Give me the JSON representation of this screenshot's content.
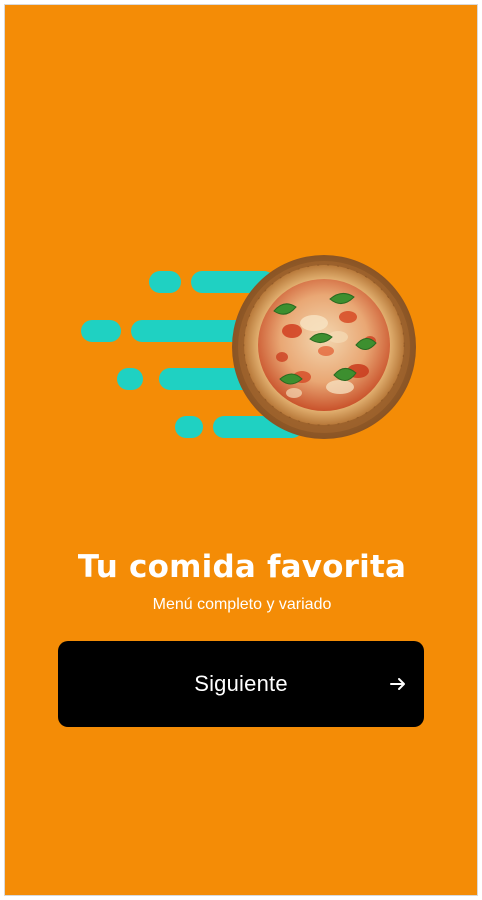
{
  "colors": {
    "background": "#F48C06",
    "accent_speed_lines": "#1FD1C2",
    "button_background": "#000000",
    "text": "#FFFFFF"
  },
  "hero": {
    "illustration": "pizza-with-speed-lines"
  },
  "content": {
    "title": "Tu comida favorita",
    "subtitle": "Menú completo y variado"
  },
  "button": {
    "label": "Siguiente",
    "icon": "arrow-right-icon"
  }
}
